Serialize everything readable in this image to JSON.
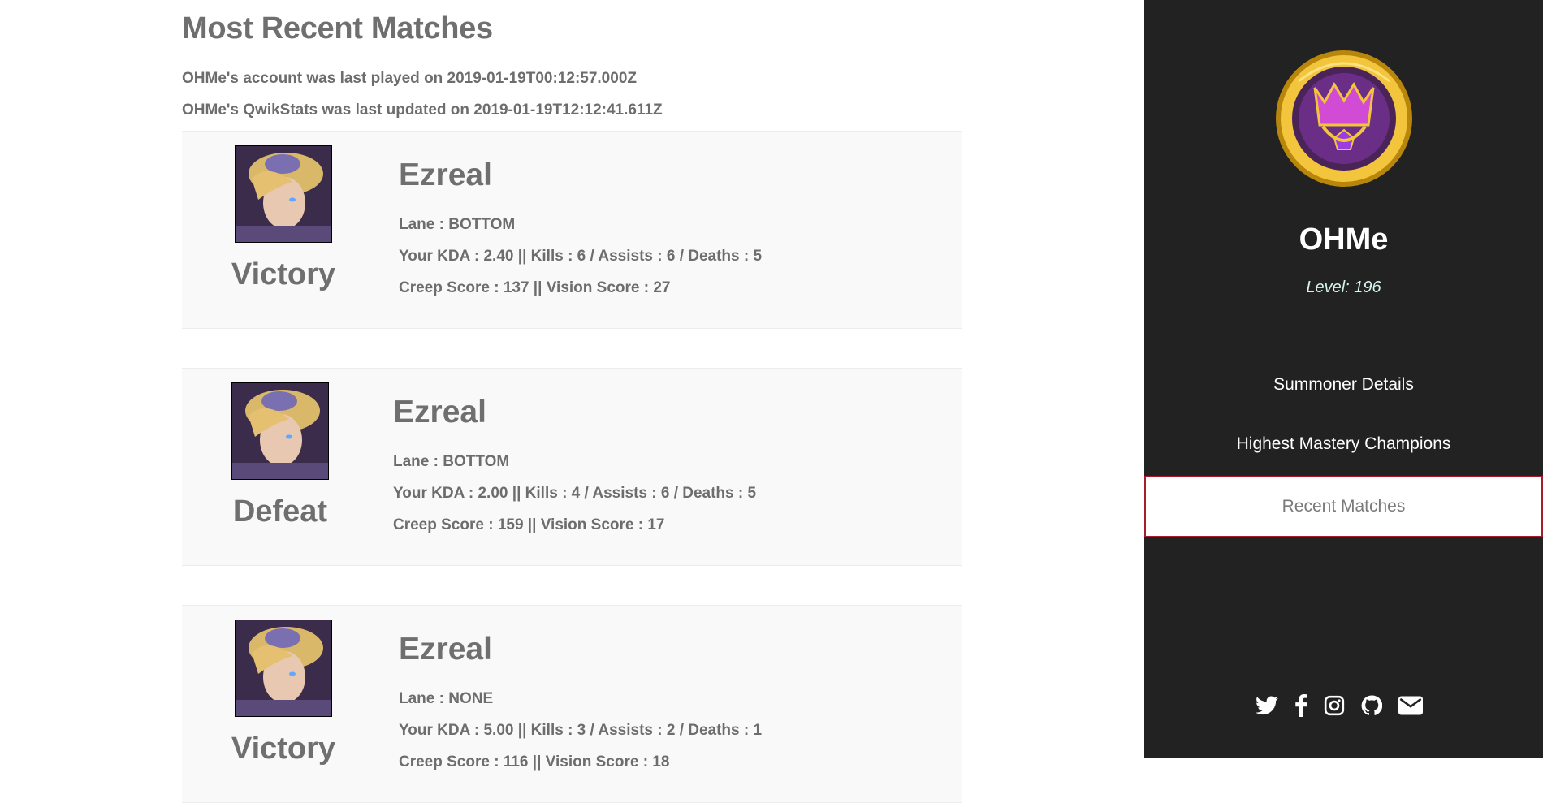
{
  "main": {
    "title": "Most Recent Matches",
    "last_played": "OHMe's account was last played on 2019-01-19T00:12:57.000Z",
    "last_updated": "OHMe's QwikStats was last updated on 2019-01-19T12:12:41.611Z",
    "matches": [
      {
        "champion": "Ezreal",
        "result": "Victory",
        "lane": "Lane : BOTTOM",
        "kda": "Your KDA : 2.40 || Kills : 6 / Assists : 6 / Deaths : 5",
        "scores": "Creep Score : 137 || Vision Score : 27"
      },
      {
        "champion": "Ezreal",
        "result": "Defeat",
        "lane": "Lane : BOTTOM",
        "kda": "Your KDA : 2.00 || Kills : 4 / Assists : 6 / Deaths : 5",
        "scores": "Creep Score : 159 || Vision Score : 17"
      },
      {
        "champion": "Ezreal",
        "result": "Victory",
        "lane": "Lane : NONE",
        "kda": "Your KDA : 5.00 || Kills : 3 / Assists : 2 / Deaths : 1",
        "scores": "Creep Score : 116 || Vision Score : 18"
      }
    ]
  },
  "sidebar": {
    "summoner_name": "OHMe",
    "level": "Level: 196",
    "nav": {
      "summoner_details": "Summoner Details",
      "highest_mastery": "Highest Mastery Champions",
      "recent_matches": "Recent Matches"
    },
    "socials": [
      "twitter-icon",
      "facebook-icon",
      "instagram-icon",
      "github-icon",
      "envelope-icon"
    ]
  },
  "colors": {
    "sidebar_bg": "#222222",
    "active_border": "#a51d2d",
    "card_bg": "#f9f9f9",
    "text_gray": "#6d6d6d"
  }
}
